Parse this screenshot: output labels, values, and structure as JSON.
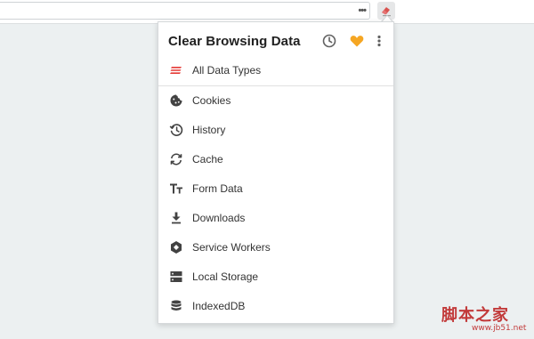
{
  "browser": {
    "overflow_menu": "•••",
    "extension_icon": "eraser-icon"
  },
  "popup": {
    "title": "Clear Browsing Data",
    "header_icons": [
      "clock-icon",
      "heart-icon",
      "more-vert-icon"
    ],
    "accent_color": "#f5a623",
    "all_types_color": "#e53935",
    "items": [
      {
        "label": "All Data Types",
        "icon": "all-data-icon"
      },
      {
        "label": "Cookies",
        "icon": "cookie-icon"
      },
      {
        "label": "History",
        "icon": "history-icon"
      },
      {
        "label": "Cache",
        "icon": "refresh-icon"
      },
      {
        "label": "Form Data",
        "icon": "text-fields-icon"
      },
      {
        "label": "Downloads",
        "icon": "download-icon"
      },
      {
        "label": "Service Workers",
        "icon": "service-worker-icon"
      },
      {
        "label": "Local Storage",
        "icon": "storage-icon"
      },
      {
        "label": "IndexedDB",
        "icon": "database-icon"
      }
    ]
  },
  "watermark": {
    "text": "脚本之家",
    "url": "www.jb51.net"
  }
}
